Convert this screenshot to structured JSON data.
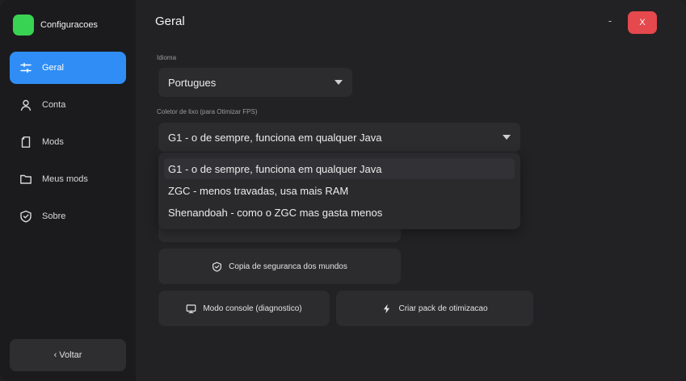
{
  "brand": {
    "title": "Configuracoes",
    "color": "#39d353"
  },
  "sidebar": {
    "items": [
      {
        "label": "Geral",
        "icon": "sliders-icon",
        "active": true
      },
      {
        "label": "Conta",
        "icon": "user-icon",
        "active": false
      },
      {
        "label": "Mods",
        "icon": "file-icon",
        "active": false
      },
      {
        "label": "Meus mods",
        "icon": "folder-icon",
        "active": false
      },
      {
        "label": "Sobre",
        "icon": "shield-check-icon",
        "active": false
      }
    ],
    "back_label": "‹ Voltar",
    "accent": "#2f8df5"
  },
  "header": {
    "title": "Geral",
    "minimize": "-",
    "close": "X",
    "close_color": "#e5484d"
  },
  "language": {
    "label": "Idioma",
    "value": "Portugues"
  },
  "gc": {
    "label": "Coletor de lixo (para Otimizar FPS)",
    "value": "G1  -  o de sempre, funciona em qualquer Java",
    "options": [
      "G1  -  o de sempre, funciona em qualquer Java",
      "ZGC  -  menos travadas, usa mais RAM",
      "Shenandoah  -  como o ZGC mas gasta menos"
    ]
  },
  "buttons": {
    "backup": "Copia de seguranca dos mundos",
    "console": "Modo console (diagnostico)",
    "pack": "Criar pack de otimizacao"
  }
}
